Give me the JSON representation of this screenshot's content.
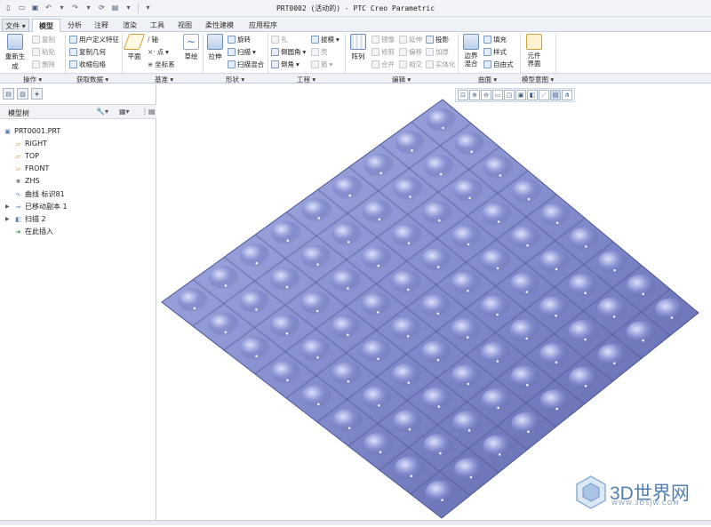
{
  "window": {
    "title": "PRT0002 (活动的) - PTC Creo Parametric"
  },
  "quick_access": [
    "new-icon",
    "open-icon",
    "save-icon",
    "undo-icon",
    "undo-dropdown",
    "redo-icon",
    "redo-dropdown",
    "regenerate-icon",
    "windows-icon",
    "windows-dropdown",
    "customize-icon"
  ],
  "tabs": [
    {
      "label": "文件",
      "file": true
    },
    {
      "label": "模型",
      "active": true
    },
    {
      "label": "分析"
    },
    {
      "label": "注释"
    },
    {
      "label": "渲染"
    },
    {
      "label": "工具"
    },
    {
      "label": "视图"
    },
    {
      "label": "柔性建模"
    },
    {
      "label": "应用程序"
    }
  ],
  "ribbon": {
    "ops": {
      "regen": "重新生成",
      "copy": "复制",
      "paste": "粘贴",
      "delete": "删除"
    },
    "getdata": {
      "udf": "用户定义特征",
      "copygeom": "复制几何",
      "shrinkwrap": "收缩包络"
    },
    "datum": {
      "plane": "平面",
      "axis": "轴",
      "point": "点",
      "csys": "坐标系",
      "sketch": "草绘"
    },
    "shapes": {
      "extrude": "拉伸",
      "revolve": "旋转",
      "sweep": "扫描",
      "sweptblend": "扫描混合"
    },
    "engineering": {
      "hole": "孔",
      "round": "倒圆角",
      "chamfer": "倒角",
      "draft": "拔模",
      "shell": "壳",
      "rib": "筋"
    },
    "editing": {
      "pattern": "阵列",
      "mirror": "镜像",
      "trim": "修剪",
      "merge": "合并",
      "extend": "延伸",
      "offset": "偏移",
      "intersect": "相交",
      "project": "投影",
      "thicken": "加厚",
      "solidify": "实体化"
    },
    "surfaces": {
      "boundary": "边界混合",
      "fill": "填充",
      "style": "样式",
      "freestyle": "自由式"
    },
    "intent": {
      "component_interface": "元件界面"
    }
  },
  "groups": [
    "操作 ▾",
    "获取数据 ▾",
    "基准 ▾",
    "形状 ▾",
    "工程 ▾",
    "编辑 ▾",
    "曲面 ▾",
    "模型意图 ▾"
  ],
  "model_tree": {
    "header": "模型树",
    "items": [
      {
        "label": "PRT0001.PRT",
        "icon": "part-icon"
      },
      {
        "label": "RIGHT",
        "icon": "datum-plane-icon"
      },
      {
        "label": "TOP",
        "icon": "datum-plane-icon"
      },
      {
        "label": "FRONT",
        "icon": "datum-plane-icon"
      },
      {
        "label": "ZHS",
        "icon": "csys-icon"
      },
      {
        "label": "曲线 标识81",
        "icon": "curve-icon"
      },
      {
        "label": "已移动副本 1",
        "icon": "moved-copy-icon"
      },
      {
        "label": "扫描 2",
        "icon": "sweep-feature-icon"
      },
      {
        "label": "在此插入",
        "icon": "insert-here-icon"
      }
    ]
  },
  "view_toolbar": [
    "refit-icon",
    "zoom-in-icon",
    "zoom-out-icon",
    "repaint-icon",
    "reorient-icon",
    "saved-views-icon",
    "display-style-icon",
    "datum-display-icon",
    "annotation-display-icon",
    "spin-center-icon"
  ],
  "watermark": {
    "name": "3D世界网",
    "url": "WWW.3DSJW.COM"
  },
  "colors": {
    "surface": "#7f88c9",
    "surface_dark": "#4c5493",
    "surface_light": "#c3c9ee",
    "accent": "#1e6bb8"
  }
}
